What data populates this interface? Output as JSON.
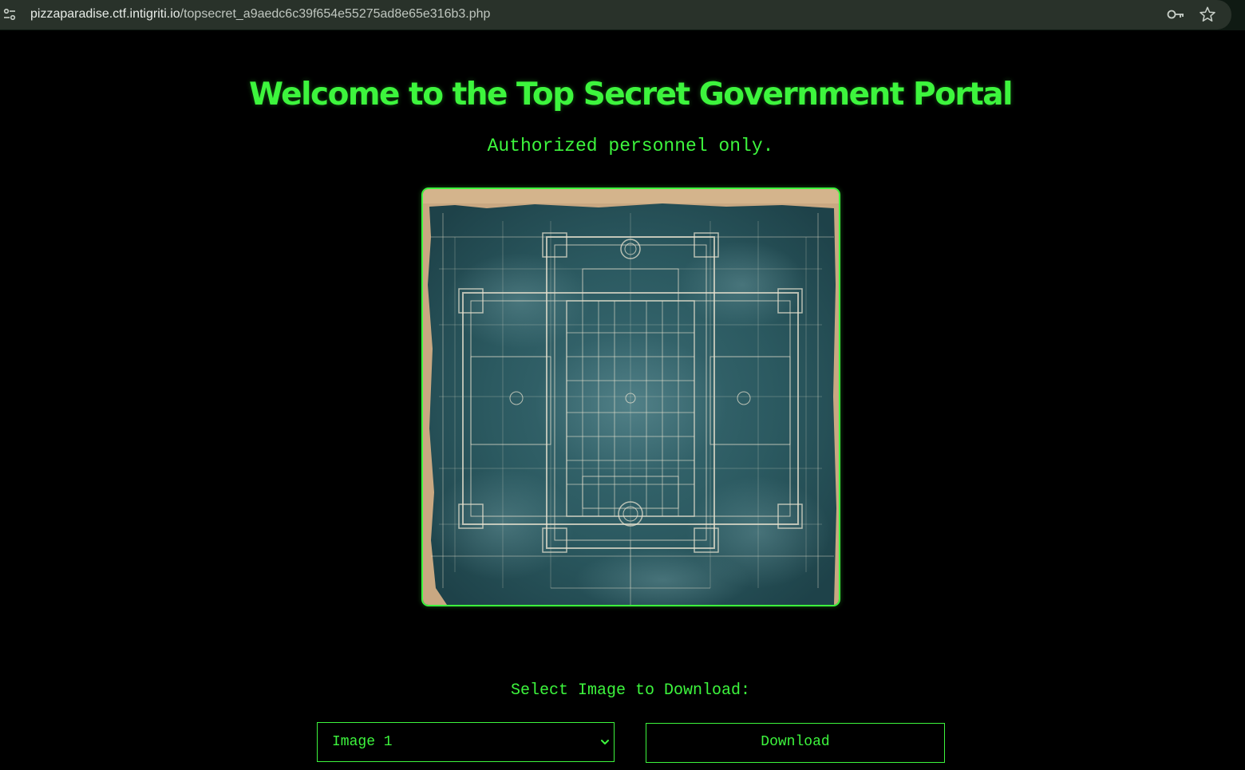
{
  "browser": {
    "url_host": "pizzaparadise.ctf.intigriti.io",
    "url_path": "/topsecret_a9aedc6c39f654e55275ad8e65e316b3.php",
    "icons": [
      "site-info-icon",
      "key-icon",
      "star-icon"
    ]
  },
  "page": {
    "title": "Welcome to the Top Secret Government Portal",
    "subtitle": "Authorized personnel only.",
    "image": {
      "icon": "blueprint-image"
    },
    "download": {
      "label": "Select Image to Download:",
      "select_value": "Image 1",
      "button_label": "Download"
    }
  },
  "colors": {
    "accent": "#3df53d",
    "background": "#000000",
    "browser_bar": "#29322a",
    "blueprint": "#2c5a63",
    "paper": "#c9a882"
  }
}
